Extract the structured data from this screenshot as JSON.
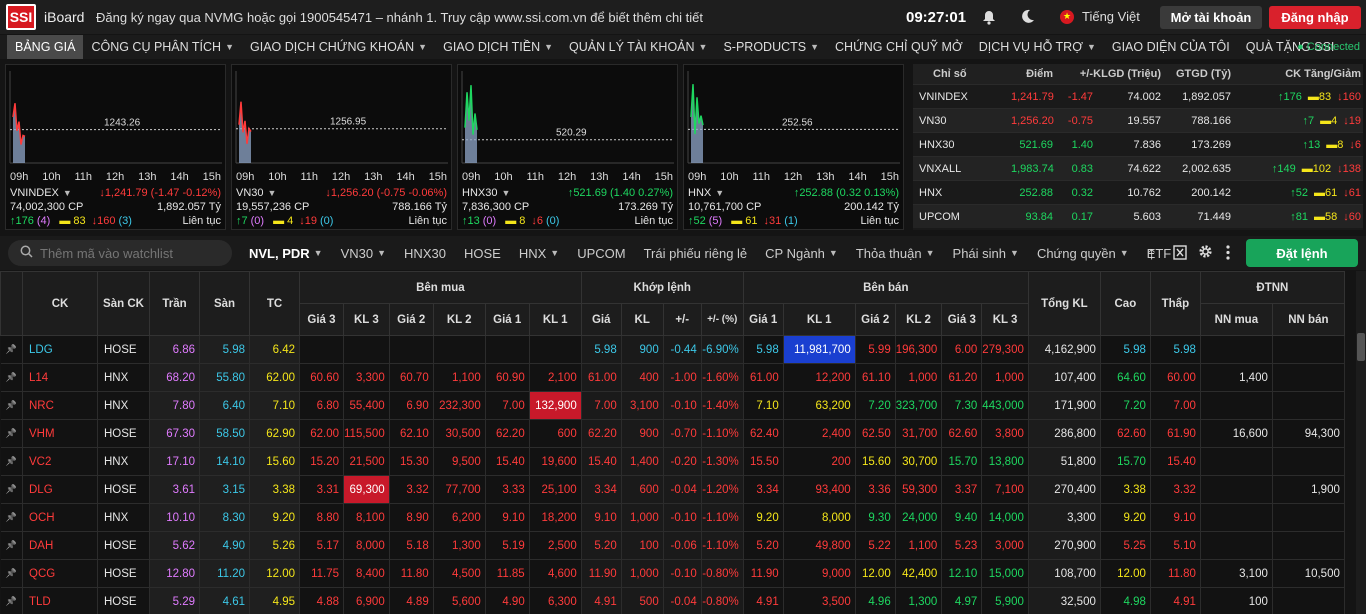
{
  "header": {
    "logo": "SSI",
    "brand": "iBoard",
    "marquee": "Đăng ký ngay qua NVMG hoặc gọi 1900545471 – nhánh 1. Truy cập www.ssi.com.vn để biết thêm chi tiết",
    "clock": "09:27:01",
    "language": "Tiếng Việt",
    "open_account": "Mở tài khoản",
    "login": "Đăng nhập",
    "flag_glyph": "★"
  },
  "menu": {
    "items": [
      {
        "label": "BẢNG GIÁ",
        "dd": false
      },
      {
        "label": "CÔNG CỤ PHÂN TÍCH",
        "dd": true
      },
      {
        "label": "GIAO DỊCH CHỨNG KHOÁN",
        "dd": true
      },
      {
        "label": "GIAO DỊCH TIỀN",
        "dd": true
      },
      {
        "label": "QUẢN LÝ TÀI KHOẢN",
        "dd": true
      },
      {
        "label": "S-PRODUCTS",
        "dd": true
      },
      {
        "label": "CHỨNG CHỈ QUỸ MỞ",
        "dd": false
      },
      {
        "label": "DỊCH VỤ HỖ TRỢ",
        "dd": true
      },
      {
        "label": "GIAO DIỆN CỦA TÔI",
        "dd": false
      },
      {
        "label": "QUÀ TẶNG SSI",
        "dd": false
      }
    ],
    "status": "● Connected"
  },
  "colors": {
    "up": "#1ed760",
    "down": "#ff3b3b",
    "ref": "#f5e61a",
    "ceil": "#e07bff",
    "floor": "#3cc8e8",
    "bg": "#141414"
  },
  "chart_data": [
    {
      "type": "area",
      "name": "VNINDEX",
      "ref": 1243.26,
      "ref_label": "1243.26",
      "ylim": [
        1236,
        1256
      ],
      "x_ticks": [
        "09h",
        "10h",
        "11h",
        "12h",
        "13h",
        "14h",
        "15h"
      ],
      "values": [
        1246,
        1249,
        1243,
        1245,
        1240,
        1242,
        1241.8
      ],
      "line_color": "#ff3b3b",
      "price": "↓1,241.79 (-1.47 -0.12%)",
      "volume": "74,002,300 CP",
      "value": "1,892.057 Tỷ",
      "up": "↑176",
      "up_ceil": "(4)",
      "ref_cnt": "83",
      "down": "↓160",
      "down_floor": "(3)",
      "session": "Liên tục",
      "change_color": "#ff3b3b"
    },
    {
      "type": "area",
      "name": "VN30",
      "ref": 1256.95,
      "ref_label": "1256.95",
      "ylim": [
        1248,
        1272
      ],
      "x_ticks": [
        "09h",
        "10h",
        "11h",
        "12h",
        "13h",
        "14h",
        "15h"
      ],
      "values": [
        1258,
        1264,
        1256,
        1259,
        1253,
        1257,
        1256.2
      ],
      "line_color": "#ff3b3b",
      "price": "↓1,256.20 (-0.75 -0.06%)",
      "volume": "19,557,236 CP",
      "value": "788.166 Tỷ",
      "up": "↑7",
      "up_ceil": "(0)",
      "ref_cnt": "4",
      "down": "↓19",
      "down_floor": "(0)",
      "session": "Liên tục",
      "change_color": "#ff3b3b"
    },
    {
      "type": "area",
      "name": "HNX30",
      "ref": 520.29,
      "ref_label": "520.29",
      "ylim": [
        517,
        530
      ],
      "x_ticks": [
        "09h",
        "10h",
        "11h",
        "12h",
        "13h",
        "14h",
        "15h"
      ],
      "values": [
        522,
        527,
        523,
        528,
        521,
        524,
        521.69
      ],
      "line_color": "#1ed760",
      "price": "↑521.69 (1.40 0.27%)",
      "volume": "7,836,300 CP",
      "value": "173.269 Tỷ",
      "up": "↑13",
      "up_ceil": "(0)",
      "ref_cnt": "8",
      "down": "↓6",
      "down_floor": "(0)",
      "session": "Liên tục",
      "change_color": "#1ed760"
    },
    {
      "type": "area",
      "name": "HNX",
      "ref": 252.56,
      "ref_label": "252.56",
      "ylim": [
        250,
        257
      ],
      "x_ticks": [
        "09h",
        "10h",
        "11h",
        "12h",
        "13h",
        "14h",
        "15h"
      ],
      "values": [
        253.5,
        256,
        252.2,
        255,
        253,
        253.6,
        252.88
      ],
      "line_color": "#1ed760",
      "price": "↑252.88 (0.32 0.13%)",
      "volume": "10,761,700 CP",
      "value": "200.142 Tỷ",
      "up": "↑52",
      "up_ceil": "(5)",
      "ref_cnt": "61",
      "down": "↓31",
      "down_floor": "(1)",
      "session": "Liên tục",
      "change_color": "#1ed760"
    }
  ],
  "index_table": {
    "headers": [
      "Chỉ số",
      "Điểm",
      "+/-",
      "KLGD (Triệu)",
      "GTGD (Tỷ)",
      "CK Tăng/Giảm"
    ],
    "rows": [
      {
        "name": "VNINDEX",
        "point": "1,241.79",
        "chg": "-1.47",
        "vol": "74.002",
        "val": "1,892.057",
        "up": "↑176",
        "ref": "83",
        "down": "↓160",
        "c": "#ff3b3b"
      },
      {
        "name": "VN30",
        "point": "1,256.20",
        "chg": "-0.75",
        "vol": "19.557",
        "val": "788.166",
        "up": "↑7",
        "ref": "4",
        "down": "↓19",
        "c": "#ff3b3b"
      },
      {
        "name": "HNX30",
        "point": "521.69",
        "chg": "1.40",
        "vol": "7.836",
        "val": "173.269",
        "up": "↑13",
        "ref": "8",
        "down": "↓6",
        "c": "#1ed760"
      },
      {
        "name": "VNXALL",
        "point": "1,983.74",
        "chg": "0.83",
        "vol": "74.622",
        "val": "2,002.635",
        "up": "↑149",
        "ref": "102",
        "down": "↓138",
        "c": "#1ed760"
      },
      {
        "name": "HNX",
        "point": "252.88",
        "chg": "0.32",
        "vol": "10.762",
        "val": "200.142",
        "up": "↑52",
        "ref": "61",
        "down": "↓61",
        "c": "#1ed760"
      },
      {
        "name": "UPCOM",
        "point": "93.84",
        "chg": "0.17",
        "vol": "5.603",
        "val": "71.449",
        "up": "↑81",
        "ref": "58",
        "down": "↓60",
        "c": "#1ed760"
      }
    ]
  },
  "toolbar": {
    "search_placeholder": "Thêm mã vào watchlist",
    "tabs": [
      {
        "label": "NVL, PDR",
        "dd": true,
        "active": true
      },
      {
        "label": "VN30",
        "dd": true
      },
      {
        "label": "HNX30",
        "dd": false
      },
      {
        "label": "HOSE",
        "dd": false
      },
      {
        "label": "HNX",
        "dd": true
      },
      {
        "label": "UPCOM",
        "dd": false
      },
      {
        "label": "Trái phiếu riêng lẻ",
        "dd": false
      },
      {
        "label": "CP Ngành",
        "dd": true
      },
      {
        "label": "Thỏa thuận",
        "dd": true
      },
      {
        "label": "Phái sinh",
        "dd": true
      },
      {
        "label": "Chứng quyền",
        "dd": true
      },
      {
        "label": "ETF",
        "dd": false
      }
    ],
    "order": "Đặt lệnh"
  },
  "board": {
    "groups": {
      "buy": "Bên mua",
      "match": "Khớp lệnh",
      "sell": "Bên bán",
      "foreign": "ĐTNN"
    },
    "cols": {
      "ck": "CK",
      "exchange": "Sàn CK",
      "ceil": "Trần",
      "floor": "Sàn",
      "ref": "TC",
      "b3": "Giá 3",
      "bk3": "KL 3",
      "b2": "Giá 2",
      "bk2": "KL 2",
      "b1": "Giá 1",
      "bk1": "KL 1",
      "mp": "Giá",
      "mk": "KL",
      "mc": "+/-",
      "mpc": "+/- (%)",
      "s1": "Giá 1",
      "sk1": "KL 1",
      "s2": "Giá 2",
      "sk2": "KL 2",
      "s3": "Giá 3",
      "sk3": "KL 3",
      "total": "Tổng KL",
      "high": "Cao",
      "low": "Thấp",
      "nnb": "NN mua",
      "nns": "NN bán"
    },
    "rows": [
      {
        "ck": "LDG",
        "ex": "HOSE",
        "ceil": "6.86",
        "floor": "5.98",
        "ref": "6.42",
        "b3": "",
        "bk3": "",
        "b2": "",
        "bk2": "",
        "b1": "",
        "bk1": "",
        "mp": "5.98",
        "mk": "900",
        "mc": "-0.44",
        "mpc": "-6.90%",
        "s1": "5.98",
        "sk1": "11,981,700",
        "s2": "5.99",
        "sk2": "196,300",
        "s3": "6.00",
        "sk3": "279,300",
        "total": "4,162,900",
        "high": "5.98",
        "low": "5.98",
        "nnb": "",
        "nns": ""
      },
      {
        "ck": "L14",
        "ex": "HNX",
        "ceil": "68.20",
        "floor": "55.80",
        "ref": "62.00",
        "b3": "60.60",
        "bk3": "3,300",
        "b2": "60.70",
        "bk2": "1,100",
        "b1": "60.90",
        "bk1": "2,100",
        "mp": "61.00",
        "mk": "400",
        "mc": "-1.00",
        "mpc": "-1.60%",
        "s1": "61.00",
        "sk1": "12,200",
        "s2": "61.10",
        "sk2": "1,000",
        "s3": "61.20",
        "sk3": "1,000",
        "total": "107,400",
        "high": "64.60",
        "low": "60.00",
        "nnb": "1,400",
        "nns": ""
      },
      {
        "ck": "NRC",
        "ex": "HNX",
        "ceil": "7.80",
        "floor": "6.40",
        "ref": "7.10",
        "b3": "6.80",
        "bk3": "55,400",
        "b2": "6.90",
        "bk2": "232,300",
        "b1": "7.00",
        "bk1": "132,900",
        "mp": "7.00",
        "mk": "3,100",
        "mc": "-0.10",
        "mpc": "-1.40%",
        "s1": "7.10",
        "sk1": "63,200",
        "s2": "7.20",
        "sk2": "323,700",
        "s3": "7.30",
        "sk3": "443,000",
        "total": "171,900",
        "high": "7.20",
        "low": "7.00",
        "nnb": "",
        "nns": ""
      },
      {
        "ck": "VHM",
        "ex": "HOSE",
        "ceil": "67.30",
        "floor": "58.50",
        "ref": "62.90",
        "b3": "62.00",
        "bk3": "115,500",
        "b2": "62.10",
        "bk2": "30,500",
        "b1": "62.20",
        "bk1": "600",
        "mp": "62.20",
        "mk": "900",
        "mc": "-0.70",
        "mpc": "-1.10%",
        "s1": "62.40",
        "sk1": "2,400",
        "s2": "62.50",
        "sk2": "31,700",
        "s3": "62.60",
        "sk3": "3,800",
        "total": "286,800",
        "high": "62.60",
        "low": "61.90",
        "nnb": "16,600",
        "nns": "94,300"
      },
      {
        "ck": "VC2",
        "ex": "HNX",
        "ceil": "17.10",
        "floor": "14.10",
        "ref": "15.60",
        "b3": "15.20",
        "bk3": "21,500",
        "b2": "15.30",
        "bk2": "9,500",
        "b1": "15.40",
        "bk1": "19,600",
        "mp": "15.40",
        "mk": "1,400",
        "mc": "-0.20",
        "mpc": "-1.30%",
        "s1": "15.50",
        "sk1": "200",
        "s2": "15.60",
        "sk2": "30,700",
        "s3": "15.70",
        "sk3": "13,800",
        "total": "51,800",
        "high": "15.70",
        "low": "15.40",
        "nnb": "",
        "nns": ""
      },
      {
        "ck": "DLG",
        "ex": "HOSE",
        "ceil": "3.61",
        "floor": "3.15",
        "ref": "3.38",
        "b3": "3.31",
        "bk3": "69,300",
        "b2": "3.32",
        "bk2": "77,700",
        "b1": "3.33",
        "bk1": "25,100",
        "mp": "3.34",
        "mk": "600",
        "mc": "-0.04",
        "mpc": "-1.20%",
        "s1": "3.34",
        "sk1": "93,400",
        "s2": "3.36",
        "sk2": "59,300",
        "s3": "3.37",
        "sk3": "7,100",
        "total": "270,400",
        "high": "3.38",
        "low": "3.32",
        "nnb": "",
        "nns": "1,900"
      },
      {
        "ck": "OCH",
        "ex": "HNX",
        "ceil": "10.10",
        "floor": "8.30",
        "ref": "9.20",
        "b3": "8.80",
        "bk3": "8,100",
        "b2": "8.90",
        "bk2": "6,200",
        "b1": "9.10",
        "bk1": "18,200",
        "mp": "9.10",
        "mk": "1,000",
        "mc": "-0.10",
        "mpc": "-1.10%",
        "s1": "9.20",
        "sk1": "8,000",
        "s2": "9.30",
        "sk2": "24,000",
        "s3": "9.40",
        "sk3": "14,000",
        "total": "3,300",
        "high": "9.20",
        "low": "9.10",
        "nnb": "",
        "nns": ""
      },
      {
        "ck": "DAH",
        "ex": "HOSE",
        "ceil": "5.62",
        "floor": "4.90",
        "ref": "5.26",
        "b3": "5.17",
        "bk3": "8,000",
        "b2": "5.18",
        "bk2": "1,300",
        "b1": "5.19",
        "bk1": "2,500",
        "mp": "5.20",
        "mk": "100",
        "mc": "-0.06",
        "mpc": "-1.10%",
        "s1": "5.20",
        "sk1": "49,800",
        "s2": "5.22",
        "sk2": "1,100",
        "s3": "5.23",
        "sk3": "3,000",
        "total": "270,900",
        "high": "5.25",
        "low": "5.10",
        "nnb": "",
        "nns": ""
      },
      {
        "ck": "QCG",
        "ex": "HOSE",
        "ceil": "12.80",
        "floor": "11.20",
        "ref": "12.00",
        "b3": "11.75",
        "bk3": "8,400",
        "b2": "11.80",
        "bk2": "4,500",
        "b1": "11.85",
        "bk1": "4,600",
        "mp": "11.90",
        "mk": "1,000",
        "mc": "-0.10",
        "mpc": "-0.80%",
        "s1": "11.90",
        "sk1": "9,000",
        "s2": "12.00",
        "sk2": "42,400",
        "s3": "12.10",
        "sk3": "15,000",
        "total": "108,700",
        "high": "12.00",
        "low": "11.80",
        "nnb": "3,100",
        "nns": "10,500"
      },
      {
        "ck": "TLD",
        "ex": "HOSE",
        "ceil": "5.29",
        "floor": "4.61",
        "ref": "4.95",
        "b3": "4.88",
        "bk3": "6,900",
        "b2": "4.89",
        "bk2": "5,600",
        "b1": "4.90",
        "bk1": "6,300",
        "mp": "4.91",
        "mk": "500",
        "mc": "-0.04",
        "mpc": "-0.80%",
        "s1": "4.91",
        "sk1": "3,500",
        "s2": "4.96",
        "sk2": "1,300",
        "s3": "4.97",
        "sk3": "5,900",
        "total": "32,500",
        "high": "4.98",
        "low": "4.91",
        "nnb": "100",
        "nns": ""
      }
    ]
  }
}
